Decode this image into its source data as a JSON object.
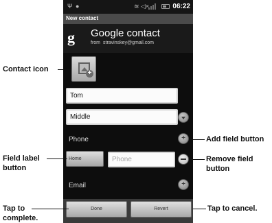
{
  "status_bar": {
    "time": "06:22",
    "icons": [
      "usb-icon",
      "notification-icon",
      "wifi-icon",
      "mute-icon",
      "signal-icon",
      "battery-icon"
    ]
  },
  "title_bar": {
    "title": "New contact"
  },
  "account": {
    "logo": "g",
    "title": "Google contact",
    "from_label": "from",
    "email": "stravinskey@gmail.com"
  },
  "form": {
    "first_name": "Tom",
    "middle_name": "Middle",
    "phone_section": "Phone",
    "phone_label_button": "Home",
    "phone_placeholder": "Phone",
    "email_section": "Email"
  },
  "bottom_bar": {
    "done": "Done",
    "revert": "Revert"
  },
  "annotations": {
    "contact_icon": "Contact icon",
    "add_field": "Add field button",
    "field_label_1": "Field label",
    "field_label_2": "button",
    "remove_field_1": "Remove field",
    "remove_field_2": "button",
    "tap_complete_1": "Tap to",
    "tap_complete_2": "complete.",
    "tap_cancel": "Tap to cancel."
  }
}
